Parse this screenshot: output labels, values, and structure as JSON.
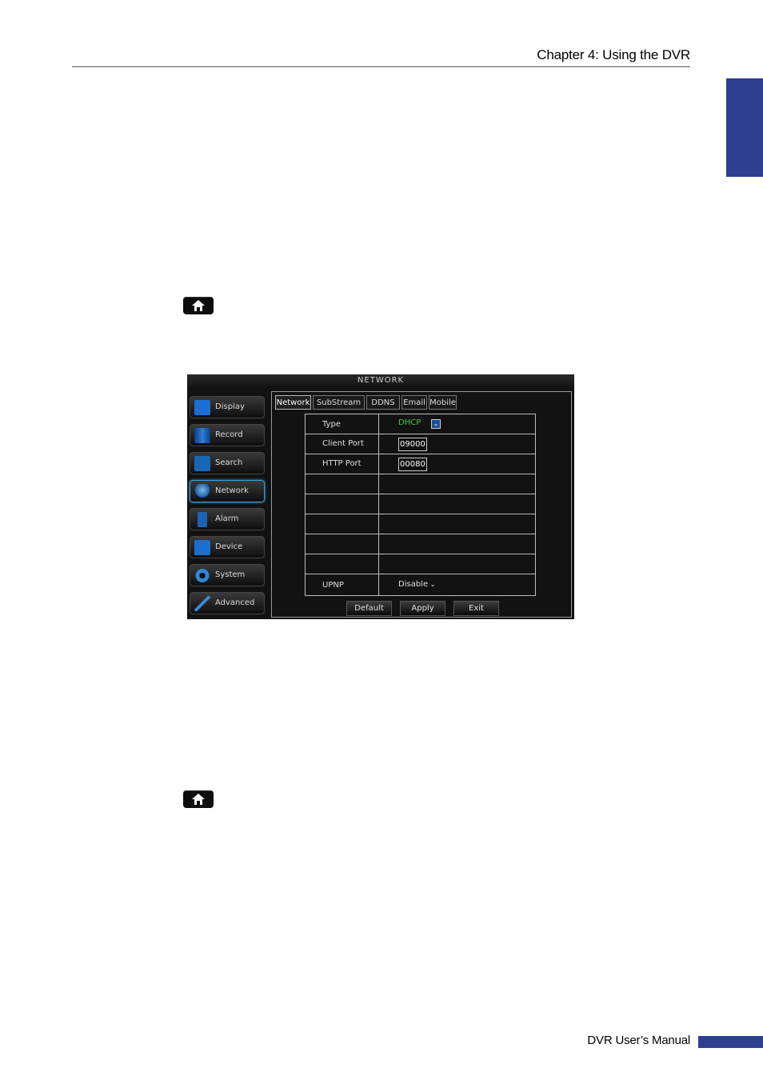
{
  "header": {
    "title": "Chapter 4: Using the DVR"
  },
  "footer": {
    "title": "DVR User’s Manual"
  },
  "colors": {
    "accent": "#2e3f91",
    "dhcp_green": "#3ecb3e"
  },
  "screenshot": {
    "title": "NETWORK",
    "menu": [
      {
        "label": "Display",
        "icon": "display-icon"
      },
      {
        "label": "Record",
        "icon": "record-icon"
      },
      {
        "label": "Search",
        "icon": "search-icon"
      },
      {
        "label": "Network",
        "icon": "network-icon",
        "active": true
      },
      {
        "label": "Alarm",
        "icon": "alarm-icon"
      },
      {
        "label": "Device",
        "icon": "device-icon"
      },
      {
        "label": "System",
        "icon": "gear-icon"
      },
      {
        "label": "Advanced",
        "icon": "wrench-icon"
      }
    ],
    "tabs": [
      "Network",
      "SubStream",
      "DDNS",
      "Email",
      "Mobile"
    ],
    "rows": {
      "type_label": "Type",
      "type_value": "DHCP",
      "client_port_label": "Client Port",
      "client_port_value": "09000",
      "http_port_label": "HTTP Port",
      "http_port_value": "00080",
      "upnp_label": "UPNP",
      "upnp_value": "Disable"
    },
    "buttons": {
      "default": "Default",
      "apply": "Apply",
      "exit": "Exit"
    }
  }
}
